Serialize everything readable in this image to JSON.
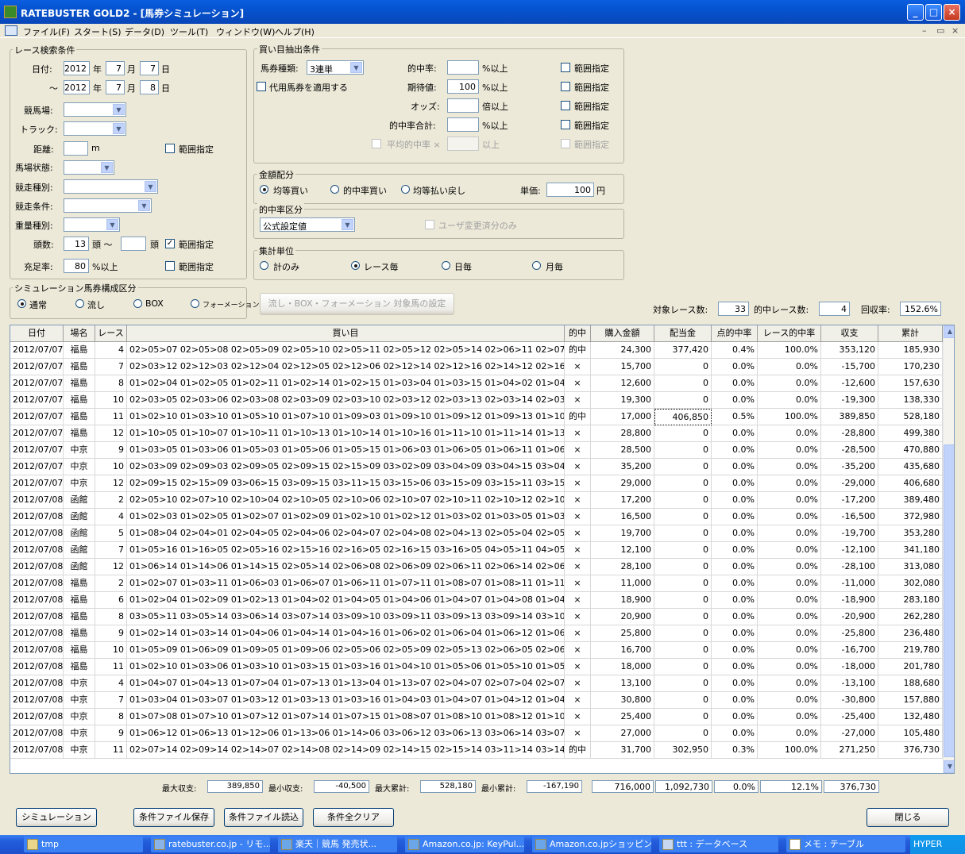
{
  "window": {
    "title": "RATEBUSTER GOLD2 - [馬券シミュレーション]",
    "btn_min": "_",
    "btn_max": "□",
    "btn_close": "×"
  },
  "menu": [
    "ファイル(F)",
    "スタート(S)",
    "データ(D)",
    "ツール(T)",
    "ウィンドウ(W)",
    "ヘルプ(H)"
  ],
  "mdi": {
    "min": "–",
    "restore": "▭",
    "close": "×"
  },
  "race_search": {
    "title": "レース検索条件",
    "date_label": "日付:",
    "tilde": "～",
    "from": {
      "year": "2012",
      "month": "7",
      "day": "7"
    },
    "to": {
      "year": "2012",
      "month": "7",
      "day": "8"
    },
    "year_unit": "年",
    "month_unit": "月",
    "day_unit": "日",
    "venue_label": "競馬場:",
    "track_label": "トラック:",
    "distance_label": "距離:",
    "distance_unit": "m",
    "range_label": "範囲指定",
    "condition_label": "馬場状態:",
    "race_type_label": "競走種別:",
    "race_cond_label": "競走条件:",
    "weight_label": "重量種別:",
    "heads_label": "頭数:",
    "heads_from": "13",
    "heads_unit": "頭 ～",
    "heads_unit2": "頭",
    "fill_label": "充足率:",
    "fill_value": "80",
    "fill_unit": "%以上"
  },
  "sim_kind": {
    "title": "シミュレーション馬券構成区分",
    "options": [
      "通常",
      "流し",
      "BOX",
      "フォーメーション"
    ],
    "selected": 0
  },
  "buy_extract": {
    "title": "買い目抽出条件",
    "ticket_label": "馬券種類:",
    "ticket_value": "3連単",
    "substitute_label": "代用馬券を適用する",
    "hit_label": "的中率:",
    "hit_unit": "%以上",
    "ev_label": "期待値:",
    "ev_value": "100",
    "ev_unit": "%以上",
    "odds_label": "オッズ:",
    "odds_unit": "倍以上",
    "hit_total_label": "的中率合計:",
    "hit_total_unit": "%以上",
    "avg_hit_label": "平均的中率 ×",
    "avg_hit_unit": "以上",
    "range_label": "範囲指定"
  },
  "amount": {
    "title": "金額配分",
    "options": [
      "均等買い",
      "的中率買い",
      "均等払い戻し"
    ],
    "selected": 0,
    "unit_price_label": "単価:",
    "unit_price": "100",
    "yen": "円"
  },
  "hit_kind": {
    "title": "的中率区分",
    "value": "公式設定値",
    "user_only": "ユーザ変更済分のみ"
  },
  "agg_unit": {
    "title": "集計単位",
    "options": [
      "計のみ",
      "レース毎",
      "日毎",
      "月毎"
    ],
    "selected": 1
  },
  "formation_btn": "流し・BOX・フォーメーション 対象馬の設定",
  "stats": {
    "target_label": "対象レース数:",
    "target": "33",
    "hits_label": "的中レース数:",
    "hits": "4",
    "recovery_label": "回収率:",
    "recovery": "152.6%"
  },
  "table": {
    "headers": [
      "日付",
      "場名",
      "レース",
      "買い目",
      "的中",
      "購入金額",
      "配当金",
      "点的中率",
      "レース的中率",
      "収支",
      "累計"
    ],
    "rows": [
      [
        "2012/07/07",
        "福島",
        "4",
        "02>05>07 02>05>08 02>05>09 02>05>10 02>05>11 02>05>12 02>05>14 02>06>11 02>07>05 02>07>09 02>07>",
        "的中",
        "24,300",
        "377,420",
        "0.4%",
        "100.0%",
        "353,120",
        "185,930"
      ],
      [
        "2012/07/07",
        "福島",
        "7",
        "02>03>12 02>12>03 02>12>04 02>12>05 02>12>06 02>12>14 02>12>16 02>14>12 02>16>12 03>02>12 03>0",
        "×",
        "15,700",
        "0",
        "0.0%",
        "0.0%",
        "-15,700",
        "170,230"
      ],
      [
        "2012/07/07",
        "福島",
        "8",
        "01>02>04 01>02>05 01>02>11 01>02>14 01>02>15 01>03>04 01>03>15 01>04>02 01>04>05 01>04>07 01>04>",
        "×",
        "12,600",
        "0",
        "0.0%",
        "0.0%",
        "-12,600",
        "157,630"
      ],
      [
        "2012/07/07",
        "福島",
        "10",
        "02>03>05 02>03>06 02>03>08 02>03>09 02>03>10 02>03>12 02>03>13 02>03>14 02>03>16 02>05>03 02>0",
        "×",
        "19,300",
        "0",
        "0.0%",
        "0.0%",
        "-19,300",
        "138,330"
      ],
      [
        "2012/07/07",
        "福島",
        "11",
        "01>02>10 01>03>10 01>05>10 01>07>10 01>09>03 01>09>10 01>09>12 01>09>13 01>10>02 01>10>03 01>10",
        "的中",
        "17,000",
        "406,850",
        "0.5%",
        "100.0%",
        "389,850",
        "528,180"
      ],
      [
        "2012/07/07",
        "福島",
        "12",
        "01>10>05 01>10>07 01>10>11 01>10>13 01>10>14 01>10>16 01>11>10 01>11>14 01>13>10 01>14>10 01>1",
        "×",
        "28,800",
        "0",
        "0.0%",
        "0.0%",
        "-28,800",
        "499,380"
      ],
      [
        "2012/07/07",
        "中京",
        "9",
        "01>03>05 01>03>06 01>05>03 01>05>06 01>05>15 01>06>03 01>06>05 01>06>11 01>06>15 01>06>16 01>1",
        "×",
        "28,500",
        "0",
        "0.0%",
        "0.0%",
        "-28,500",
        "470,880"
      ],
      [
        "2012/07/07",
        "中京",
        "10",
        "02>03>09 02>09>03 02>09>05 02>09>15 02>15>09 03>02>09 03>04>09 03>04>15 03>04>17 03>05>09 03>0",
        "×",
        "35,200",
        "0",
        "0.0%",
        "0.0%",
        "-35,200",
        "435,680"
      ],
      [
        "2012/07/07",
        "中京",
        "12",
        "02>09>15 02>15>09 03>06>15 03>09>15 03>11>15 03>15>06 03>15>09 03>15>11 03>15>16 03>16>15 04>0",
        "×",
        "29,000",
        "0",
        "0.0%",
        "0.0%",
        "-29,000",
        "406,680"
      ],
      [
        "2012/07/08",
        "函館",
        "2",
        "02>05>10 02>07>10 02>10>04 02>10>05 02>10>06 02>10>07 02>10>11 02>10>12 02>10>13 02>13>10 04>0",
        "×",
        "17,200",
        "0",
        "0.0%",
        "0.0%",
        "-17,200",
        "389,480"
      ],
      [
        "2012/07/08",
        "函館",
        "4",
        "01>02>03 01>02>05 01>02>07 01>02>09 01>02>10 01>02>12 01>03>02 01>03>05 01>03>07 01>03>09 01>0",
        "×",
        "16,500",
        "0",
        "0.0%",
        "0.0%",
        "-16,500",
        "372,980"
      ],
      [
        "2012/07/08",
        "函館",
        "5",
        "01>08>04 02>04>01 02>04>05 02>04>06 02>04>07 02>04>08 02>04>13 02>05>04 02>05>08 02>06>",
        "×",
        "19,700",
        "0",
        "0.0%",
        "0.0%",
        "-19,700",
        "353,280"
      ],
      [
        "2012/07/08",
        "函館",
        "7",
        "01>05>16 01>16>05 02>05>16 02>15>16 02>16>05 02>16>15 03>16>05 04>05>11 04>05>15 04>05>16 04>1",
        "×",
        "12,100",
        "0",
        "0.0%",
        "0.0%",
        "-12,100",
        "341,180"
      ],
      [
        "2012/07/08",
        "函館",
        "12",
        "01>06>14 01>14>06 01>14>15 02>05>14 02>06>08 02>06>09 02>06>11 02>06>14 02>06>15 02>08>06 02>0",
        "×",
        "28,100",
        "0",
        "0.0%",
        "0.0%",
        "-28,100",
        "313,080"
      ],
      [
        "2012/07/08",
        "福島",
        "2",
        "01>02>07 01>03>11 01>06>03 01>06>07 01>06>11 01>07>11 01>08>07 01>08>11 01>11>02 01>11>03 01>1",
        "×",
        "11,000",
        "0",
        "0.0%",
        "0.0%",
        "-11,000",
        "302,080"
      ],
      [
        "2012/07/08",
        "福島",
        "6",
        "01>02>04 01>02>09 01>02>13 01>04>02 01>04>05 01>04>06 01>04>07 01>04>08 01>04>09 01>04>12 01>0",
        "×",
        "18,900",
        "0",
        "0.0%",
        "0.0%",
        "-18,900",
        "283,180"
      ],
      [
        "2012/07/08",
        "福島",
        "8",
        "03>05>11 03>05>14 03>06>14 03>07>14 03>09>10 03>09>11 03>09>13 03>09>14 03>10>09 03>10>14 03>1",
        "×",
        "20,900",
        "0",
        "0.0%",
        "0.0%",
        "-20,900",
        "262,280"
      ],
      [
        "2012/07/08",
        "福島",
        "9",
        "01>02>14 01>03>14 01>04>06 01>04>14 01>04>16 01>06>02 01>06>04 01>06>12 01>06>13 01>06>14 01>0",
        "×",
        "25,800",
        "0",
        "0.0%",
        "0.0%",
        "-25,800",
        "236,480"
      ],
      [
        "2012/07/08",
        "福島",
        "10",
        "01>05>09 01>06>09 01>09>05 01>09>06 02>05>06 02>05>09 02>05>13 02>06>05 02>06>09 02>06>13 02>0",
        "×",
        "16,700",
        "0",
        "0.0%",
        "0.0%",
        "-16,700",
        "219,780"
      ],
      [
        "2012/07/08",
        "福島",
        "11",
        "01>02>10 01>03>06 01>03>10 01>03>15 01>03>16 01>04>10 01>05>06 01>05>10 01>05>14 01>05>15 01>0",
        "×",
        "18,000",
        "0",
        "0.0%",
        "0.0%",
        "-18,000",
        "201,780"
      ],
      [
        "2012/07/08",
        "中京",
        "4",
        "01>04>07 01>04>13 01>07>04 01>07>13 01>13>04 01>13>07 02>04>07 02>07>04 02>07>13 04>01>07 04>0",
        "×",
        "13,100",
        "0",
        "0.0%",
        "0.0%",
        "-13,100",
        "188,680"
      ],
      [
        "2012/07/08",
        "中京",
        "7",
        "01>03>04 01>03>07 01>03>12 01>03>13 01>03>16 01>04>03 01>04>07 01>04>12 01>04>13 01>04>16 01>0",
        "×",
        "30,800",
        "0",
        "0.0%",
        "0.0%",
        "-30,800",
        "157,880"
      ],
      [
        "2012/07/08",
        "中京",
        "8",
        "01>07>08 01>07>10 01>07>12 01>07>14 01>07>15 01>08>07 01>08>10 01>08>12 01>10>08 01>10>12 01>1",
        "×",
        "25,400",
        "0",
        "0.0%",
        "0.0%",
        "-25,400",
        "132,480"
      ],
      [
        "2012/07/08",
        "中京",
        "9",
        "01>06>12 01>06>13 01>12>06 01>13>06 01>14>06 03>06>12 03>06>13 03>06>14 03>07>12 03>12>06 03>1",
        "×",
        "27,000",
        "0",
        "0.0%",
        "0.0%",
        "-27,000",
        "105,480"
      ],
      [
        "2012/07/08",
        "中京",
        "11",
        "02>07>14 02>09>14 02>14>07 02>14>08 02>14>09 02>14>15 02>15>14 03>11>14 03>14>11 04>06>14 04>0",
        "的中",
        "31,700",
        "302,950",
        "0.3%",
        "100.0%",
        "271,250",
        "376,730"
      ]
    ]
  },
  "footer": {
    "max_balance_label": "最大収支:",
    "max_balance": "389,850",
    "min_balance_label": "最小収支:",
    "min_balance": "-40,500",
    "max_cum_label": "最大累計:",
    "max_cum": "528,180",
    "min_cum_label": "最小累計:",
    "min_cum": "-167,190",
    "total_buy": "716,000",
    "total_payout": "1,092,730",
    "total_point_hit": "0.0%",
    "total_race_hit": "12.1%",
    "total_balance": "376,730"
  },
  "buttons": {
    "simulate": "シミュレーション",
    "save": "条件ファイル保存",
    "load": "条件ファイル読込",
    "clear": "条件全クリア",
    "close": "閉じる"
  },
  "taskbar": {
    "items": [
      "tmp",
      "ratebuster.co.jp - リモ...",
      "楽天｜競馬 発売状...",
      "Amazon.co.jp: KeyPul...",
      "Amazon.co.jpショッピン...",
      "ttt : データベース",
      "メモ : テーブル"
    ],
    "tray": "HYPER"
  }
}
